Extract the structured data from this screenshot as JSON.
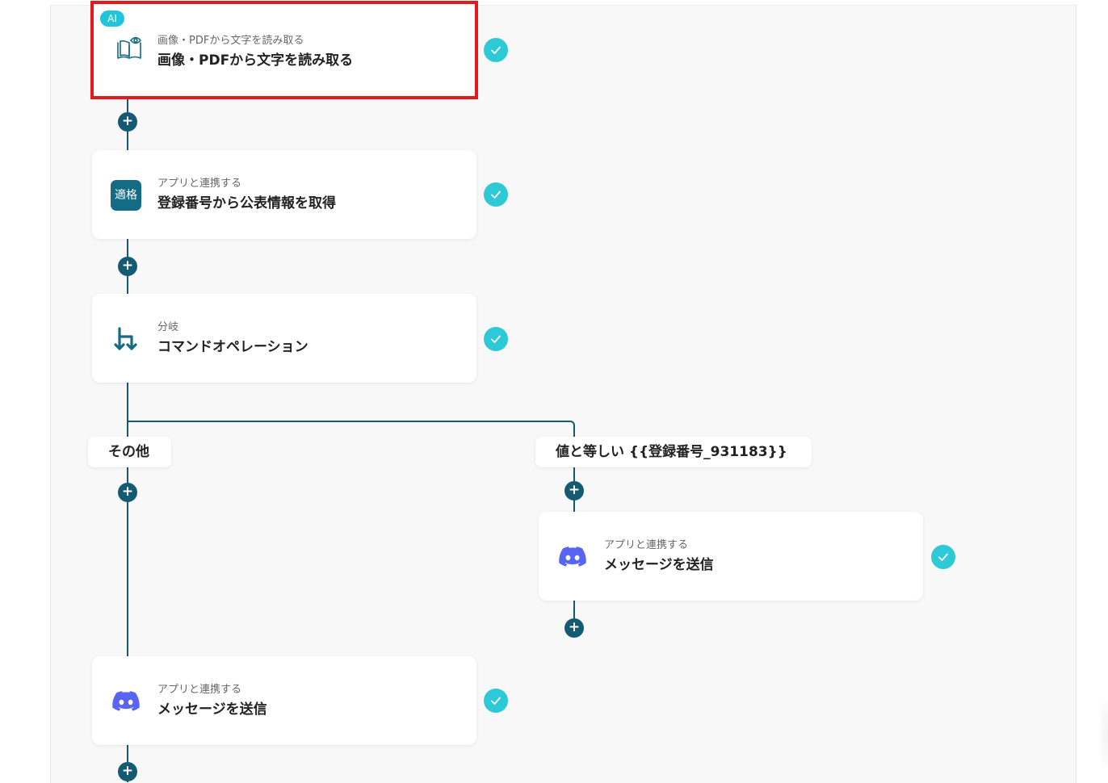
{
  "flow": {
    "steps": [
      {
        "sub": "画像・PDFから文字を読み取る",
        "title": "画像・PDFから文字を読み取る",
        "badge": "AI",
        "icon": "book-eye-icon"
      },
      {
        "sub": "アプリと連携する",
        "title": "登録番号から公表情報を取得",
        "icon_text": "適格",
        "icon": "app-tile-icon"
      },
      {
        "sub": "分岐",
        "title": "コマンドオペレーション",
        "icon": "branch-icon"
      },
      {
        "sub": "アプリと連携する",
        "title": "メッセージを送信",
        "icon": "discord-icon"
      },
      {
        "sub": "アプリと連携する",
        "title": "メッセージを送信",
        "icon": "discord-icon"
      }
    ],
    "branches": {
      "other": "その他",
      "equals": "値と等しい {{登録番号_931183}}"
    },
    "add_symbol": "+",
    "colors": {
      "connector": "#19586e",
      "check": "#2dc9d6",
      "highlight": "#e3191b",
      "ai_badge": "#22c4d8",
      "discord": "#5865f2"
    }
  }
}
